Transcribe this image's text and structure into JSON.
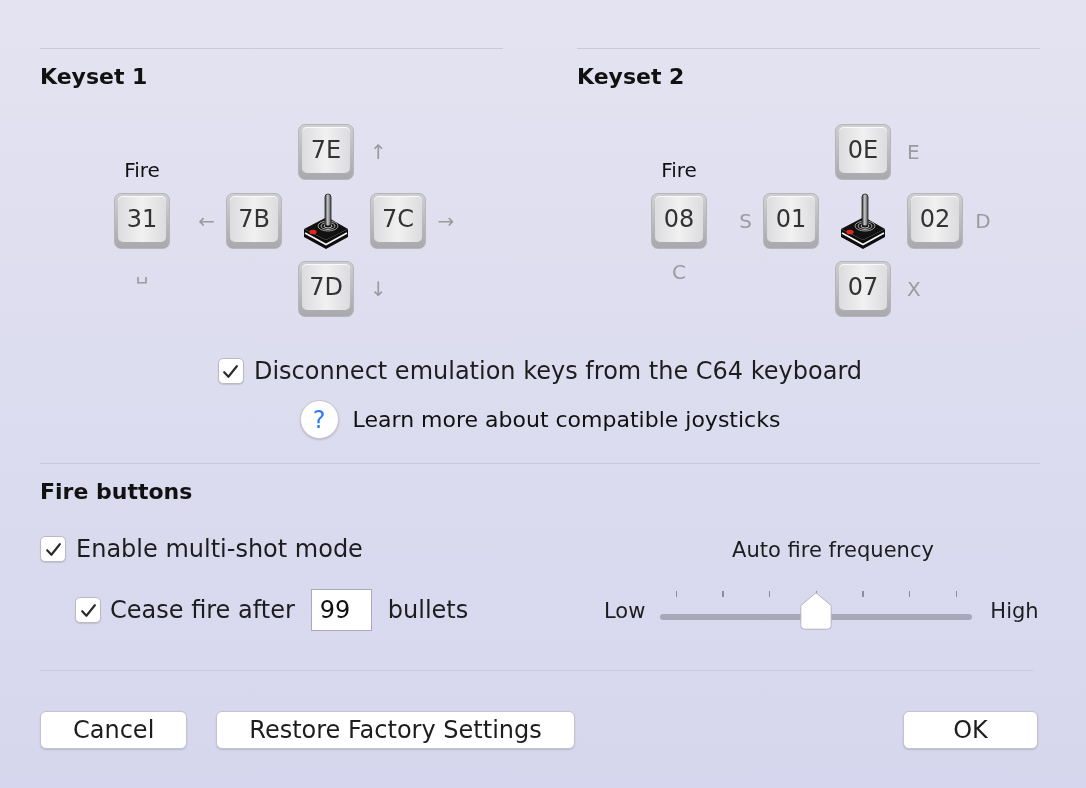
{
  "keysets": [
    {
      "title": "Keyset 1",
      "fire": {
        "label": "Fire",
        "key": "31",
        "hint": "␣"
      },
      "up": {
        "key": "7E",
        "hint": "↑"
      },
      "left": {
        "key": "7B",
        "hint": "←"
      },
      "right": {
        "key": "7C",
        "hint": "→"
      },
      "down": {
        "key": "7D",
        "hint": "↓"
      }
    },
    {
      "title": "Keyset 2",
      "fire": {
        "label": "Fire",
        "key": "08",
        "hint": "C"
      },
      "up": {
        "key": "0E",
        "hint": "E"
      },
      "left": {
        "key": "01",
        "hint": "S"
      },
      "right": {
        "key": "02",
        "hint": "D"
      },
      "down": {
        "key": "07",
        "hint": "X"
      }
    }
  ],
  "disconnect": {
    "label": "Disconnect emulation keys from the C64 keyboard",
    "checked": true
  },
  "help": {
    "glyph": "?",
    "label": "Learn more about compatible joysticks"
  },
  "fire_buttons": {
    "title": "Fire buttons",
    "multi_shot": {
      "label": "Enable multi-shot mode",
      "checked": true
    },
    "cease_fire": {
      "label": "Cease fire after",
      "value": "99",
      "unit": "bullets",
      "checked": true
    },
    "auto_fire": {
      "title": "Auto fire frequency",
      "low": "Low",
      "high": "High",
      "level": 0.5
    }
  },
  "buttons": [
    {
      "label": "Cancel"
    },
    {
      "label": "Restore Factory Settings"
    },
    {
      "label": "OK"
    }
  ]
}
